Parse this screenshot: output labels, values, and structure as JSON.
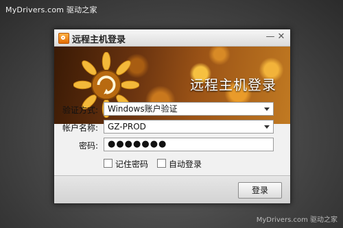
{
  "watermark": {
    "top": "MyDrivers.com 驱动之家",
    "bottom": "MyDrivers.com 驱动之家"
  },
  "dialog": {
    "title": "远程主机登录",
    "controls": {
      "minimize": "—",
      "close": "✕"
    },
    "banner": {
      "title": "远程主机登录"
    },
    "form": {
      "auth_method": {
        "label": "验证方式:",
        "value": "Windows账户验证"
      },
      "account": {
        "label": "帐户名称:",
        "value": "GZ-PROD"
      },
      "password": {
        "label": "密码:",
        "masked_value": "●●●●●●●"
      }
    },
    "options": {
      "remember_password": {
        "label": "记住密码",
        "checked": false
      },
      "auto_login": {
        "label": "自动登录",
        "checked": false
      }
    },
    "buttons": {
      "login": "登录"
    }
  },
  "icons": {
    "app": "app-logo-icon",
    "minimize": "minimize-icon",
    "close": "close-icon",
    "dropdown": "chevron-down-icon",
    "banner": "sunflower-logo-icon"
  },
  "colors": {
    "banner_dark": "#3a1a05",
    "banner_light": "#c17a22",
    "accent": "#e26a00"
  }
}
